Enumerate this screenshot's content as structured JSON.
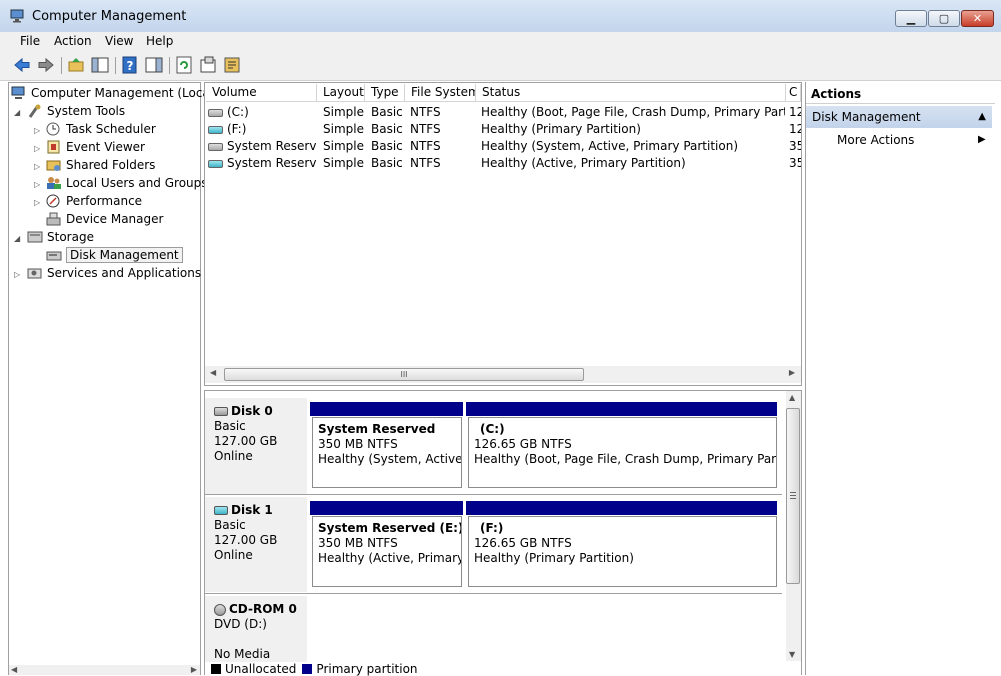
{
  "window": {
    "title": "Computer Management"
  },
  "menu": [
    "File",
    "Action",
    "View",
    "Help"
  ],
  "toolbar": {
    "buttons": [
      "back-icon",
      "forward-icon",
      "up-folder-icon",
      "show-hide-tree-icon",
      "help-icon",
      "show-hide-action-pane-icon",
      "refresh-icon",
      "properties-icon",
      "export-icon"
    ]
  },
  "tree": {
    "root": "Computer Management (Local)",
    "system_tools": "System Tools",
    "task_scheduler": "Task Scheduler",
    "event_viewer": "Event Viewer",
    "shared_folders": "Shared Folders",
    "local_users": "Local Users and Groups",
    "performance": "Performance",
    "device_manager": "Device Manager",
    "storage": "Storage",
    "disk_management": "Disk Management",
    "services": "Services and Applications"
  },
  "volumes": {
    "columns": [
      "Volume",
      "Layout",
      "Type",
      "File System",
      "Status",
      "C"
    ],
    "rows": [
      {
        "volume": "(C:)",
        "layout": "Simple",
        "type": "Basic",
        "fs": "NTFS",
        "status": "Healthy (Boot, Page File, Crash Dump, Primary Partition)",
        "cap": "12"
      },
      {
        "volume": "(F:)",
        "layout": "Simple",
        "type": "Basic",
        "fs": "NTFS",
        "status": "Healthy (Primary Partition)",
        "cap": "12"
      },
      {
        "volume": "System Reserved",
        "layout": "Simple",
        "type": "Basic",
        "fs": "NTFS",
        "status": "Healthy (System, Active, Primary Partition)",
        "cap": "35"
      },
      {
        "volume": "System Reserve...",
        "layout": "Simple",
        "type": "Basic",
        "fs": "NTFS",
        "status": "Healthy (Active, Primary Partition)",
        "cap": "35"
      }
    ]
  },
  "disks": [
    {
      "name": "Disk 0",
      "type": "Basic",
      "size": "127.00 GB",
      "state": "Online",
      "partitions": [
        {
          "name": "System Reserved",
          "size": "350 MB NTFS",
          "status": "Healthy (System, Active, Pr"
        },
        {
          "name": "(C:)",
          "size": "126.65 GB NTFS",
          "status": "Healthy (Boot, Page File, Crash Dump, Primary Partition)"
        }
      ]
    },
    {
      "name": "Disk 1",
      "type": "Basic",
      "size": "127.00 GB",
      "state": "Online",
      "partitions": [
        {
          "name": "System Reserved  (E:)",
          "size": "350 MB NTFS",
          "status": "Healthy (Active, Primary Pa"
        },
        {
          "name": "(F:)",
          "size": "126.65 GB NTFS",
          "status": "Healthy (Primary Partition)"
        }
      ]
    },
    {
      "name": "CD-ROM 0",
      "type": "DVD (D:)",
      "state": "No Media"
    }
  ],
  "legend": {
    "unallocated": "Unallocated",
    "unallocated_color": "#000000",
    "primary": "Primary partition",
    "primary_color": "#00008b"
  },
  "actions": {
    "header": "Actions",
    "section": "Disk Management",
    "more": "More Actions"
  }
}
